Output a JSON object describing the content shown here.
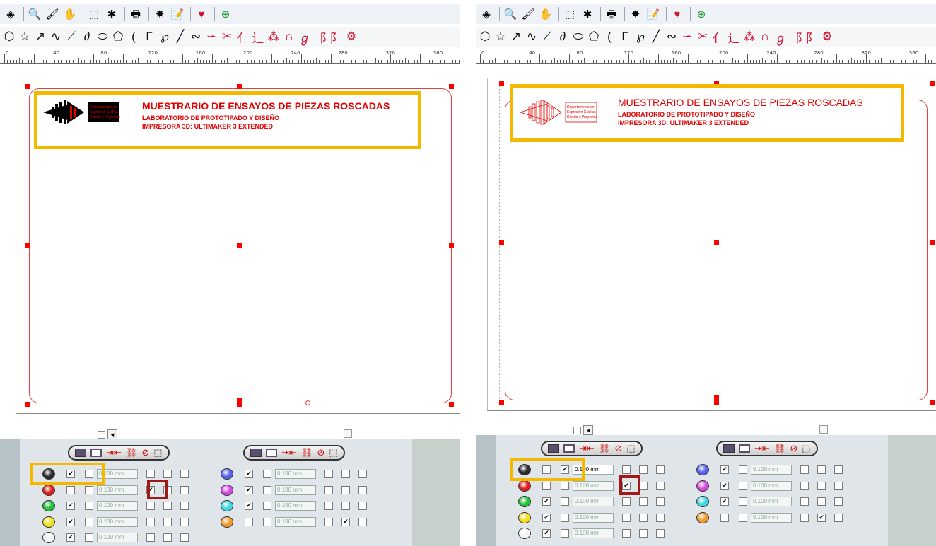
{
  "document": {
    "title": "MUESTRARIO DE ENSAYOS DE PIEZAS ROSCADAS",
    "subtitle1": "LABORATORIO DE PROTOTIPADO Y DISEÑO",
    "subtitle2": "IMPRESORA 3D: ULTIMAKER 3 EXTENDED",
    "logo_line1": "Departamento de",
    "logo_line2": "Expresión Gráfica,",
    "logo_line3": "Diseño y Proyectos"
  },
  "ruler": {
    "labels": [
      "0",
      "40",
      "80",
      "120",
      "160",
      "200",
      "240",
      "280",
      "320",
      "360"
    ]
  },
  "toolbar": {
    "icons": [
      "layers-icon",
      "zoom-icon",
      "brush-icon",
      "hand-icon",
      "select-icon",
      "snowflake-icon",
      "print-icon",
      "laser-icon",
      "notes-icon",
      "heart-icon",
      "machine-icon"
    ],
    "glyphs": [
      "◈",
      "🔍",
      "🖌",
      "✋",
      "⬚",
      "✱",
      "🖶",
      "✸",
      "📝",
      "♥",
      "⊕"
    ]
  },
  "shapes": {
    "glyphs": [
      "⬡",
      "☆",
      "↗",
      "∿",
      "⟋",
      "∂",
      "⬭",
      "⬠",
      "(",
      "Γ",
      "℘",
      "╱",
      "∾",
      "∽",
      "✂",
      "⺅",
      "⻌",
      "⁂",
      "∩",
      "ℊ",
      "⻏",
      "⻖",
      "⚙"
    ]
  },
  "layers": {
    "thickness": "0.100 mm",
    "left_panel": {
      "col1": [
        {
          "color": "black",
          "c1": true,
          "c2": false,
          "f1": false,
          "f2": false,
          "f3": false
        },
        {
          "color": "red",
          "c1": false,
          "c2": false,
          "f1": true,
          "f2": false,
          "f3": false
        },
        {
          "color": "green",
          "c1": true,
          "c2": false,
          "f1": false,
          "f2": false,
          "f3": false
        },
        {
          "color": "yellow",
          "c1": true,
          "c2": false,
          "f1": false,
          "f2": false,
          "f3": false
        },
        {
          "color": "white",
          "c1": true,
          "c2": false,
          "f1": false,
          "f2": false,
          "f3": false
        }
      ],
      "col2": [
        {
          "color": "blue",
          "c1": true,
          "c2": false,
          "f1": false,
          "f2": false,
          "f3": false
        },
        {
          "color": "magenta",
          "c1": true,
          "c2": false,
          "f1": false,
          "f2": false,
          "f3": false
        },
        {
          "color": "cyan",
          "c1": true,
          "c2": false,
          "f1": false,
          "f2": false,
          "f3": false
        },
        {
          "color": "orange",
          "c1": false,
          "c2": false,
          "f1": false,
          "f2": true,
          "f3": false
        }
      ]
    },
    "right_panel": {
      "col1": [
        {
          "color": "black",
          "c1": false,
          "c2": true,
          "f1": false,
          "f2": false,
          "f3": false
        },
        {
          "color": "red",
          "c1": false,
          "c2": false,
          "f1": true,
          "f2": false,
          "f3": false
        },
        {
          "color": "green",
          "c1": true,
          "c2": false,
          "f1": false,
          "f2": false,
          "f3": false
        },
        {
          "color": "yellow",
          "c1": true,
          "c2": false,
          "f1": false,
          "f2": false,
          "f3": false
        },
        {
          "color": "white",
          "c1": true,
          "c2": false,
          "f1": false,
          "f2": false,
          "f3": false
        }
      ],
      "col2": [
        {
          "color": "blue",
          "c1": true,
          "c2": false,
          "f1": false,
          "f2": false,
          "f3": false
        },
        {
          "color": "magenta",
          "c1": true,
          "c2": false,
          "f1": false,
          "f2": false,
          "f3": false
        },
        {
          "color": "cyan",
          "c1": true,
          "c2": false,
          "f1": false,
          "f2": false,
          "f3": false
        },
        {
          "color": "orange",
          "c1": false,
          "c2": false,
          "f1": false,
          "f2": true,
          "f3": false
        }
      ]
    }
  },
  "colors": {
    "accent_highlight": "#f5b800",
    "check_highlight": "#a01818",
    "title_red": "#e30000",
    "black": "#2b2b2b",
    "red": "#e02020",
    "green": "#22c03a",
    "yellow": "#f2e020",
    "white": "#f4f4f4",
    "blue": "#5560e8",
    "magenta": "#d44ae0",
    "cyan": "#3ed6e0",
    "orange": "#f09a30"
  }
}
